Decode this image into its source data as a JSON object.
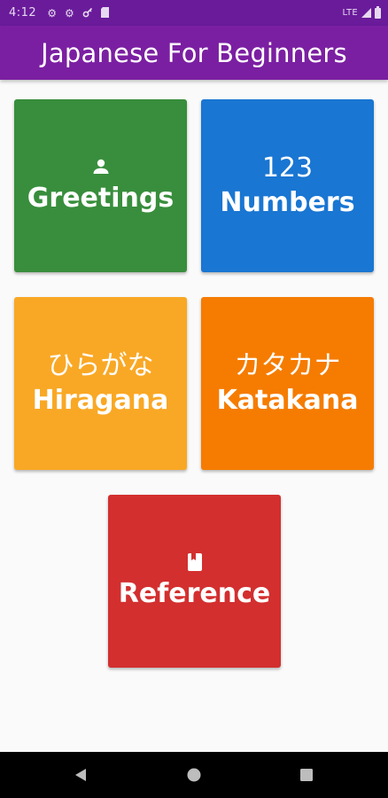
{
  "status_bar": {
    "time": "4:12",
    "network": "LTE",
    "icons": [
      "gear-icon",
      "gear-icon",
      "key-icon",
      "sd-card-icon",
      "signal-icon",
      "battery-icon"
    ]
  },
  "app_bar": {
    "title": "Japanese For Beginners",
    "color": "#7b1fa2",
    "status_color": "#6a1b9a"
  },
  "tiles": [
    {
      "line1": "",
      "line2": "Greetings",
      "icon": "person-icon",
      "color": "#388e3c"
    },
    {
      "line1": "123",
      "line2": "Numbers",
      "icon": "",
      "color": "#1976d2"
    },
    {
      "line1": "ひらがな",
      "line2": "Hiragana",
      "icon": "",
      "color": "#f9a825"
    },
    {
      "line1": "カタカナ",
      "line2": "Katakana",
      "icon": "",
      "color": "#f57c00"
    },
    {
      "line1": "",
      "line2": "Reference",
      "icon": "bookmark-book-icon",
      "color": "#d32f2f"
    }
  ],
  "nav_bar": {
    "buttons": [
      "back-triangle-icon",
      "home-circle-icon",
      "recents-square-icon"
    ]
  }
}
